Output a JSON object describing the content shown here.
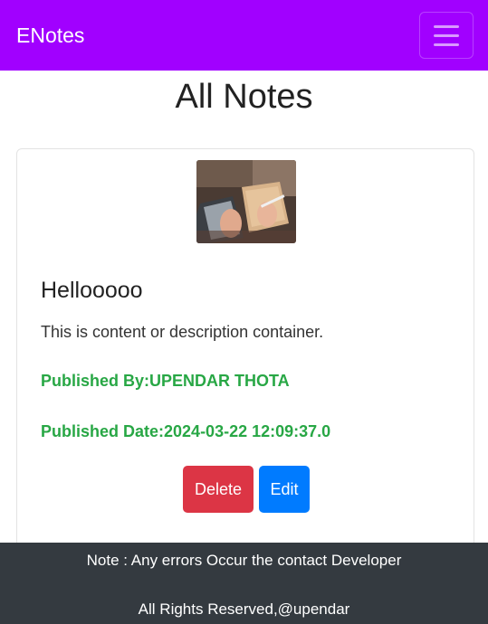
{
  "navbar": {
    "brand": "ENotes",
    "menu_icon": "hamburger-menu-icon"
  },
  "page": {
    "title": "All Notes"
  },
  "note": {
    "image_icon": "note-photo",
    "title": "Hellooooo",
    "content": "This is content or description container.",
    "published_by": "Published By:UPENDAR THOTA",
    "published_date": "Published Date:2024-03-22 12:09:37.0",
    "delete_label": "Delete",
    "edit_label": "Edit"
  },
  "footer": {
    "note": "Note : Any errors Occur the contact Developer",
    "rights": "All Rights Reserved,@upendar"
  },
  "colors": {
    "navbar": "#a100ff",
    "published": "#28a745",
    "delete": "#dc3545",
    "edit": "#007bff",
    "footer": "#343a40"
  }
}
